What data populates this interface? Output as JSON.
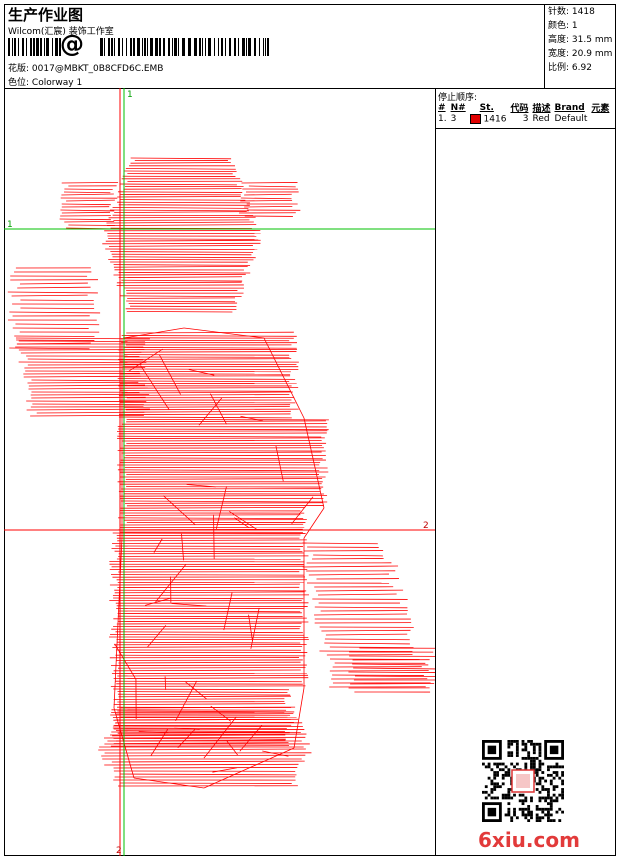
{
  "header": {
    "title": "生产作业图",
    "company": "Wilcom(汇宸) 装饰工作室",
    "design_label": "花版:",
    "design_value": "0017@MBKT_0B8CFD6C.EMB",
    "colorway_label": "色位:",
    "colorway_value": "Colorway 1",
    "barcode_at": "@"
  },
  "stats": [
    {
      "label": "针数:",
      "value": "1418"
    },
    {
      "label": "颜色:",
      "value": "1"
    },
    {
      "label": "高度:",
      "value": "31.5 mm"
    },
    {
      "label": "宽度:",
      "value": "20.9 mm"
    },
    {
      "label": "比例:",
      "value": "6.92"
    }
  ],
  "stop_sequence": {
    "label": "停止顺序:",
    "columns": [
      "#",
      "N#",
      "St.",
      "代码",
      "描述",
      "Brand",
      "元素"
    ],
    "rows": [
      {
        "num": "1.",
        "n": "3",
        "color": "#e00000",
        "stitches": "1416",
        "code": "3",
        "desc": "Red",
        "brand": "Default",
        "element": ""
      }
    ]
  },
  "guides": {
    "h1": "1",
    "h2": "2",
    "v1": "1",
    "v2": "2"
  },
  "colors": {
    "stitch": "#ff0000",
    "guide_green": "#00c000",
    "guide_red": "#ff0000"
  },
  "watermark": "6xiu.com"
}
